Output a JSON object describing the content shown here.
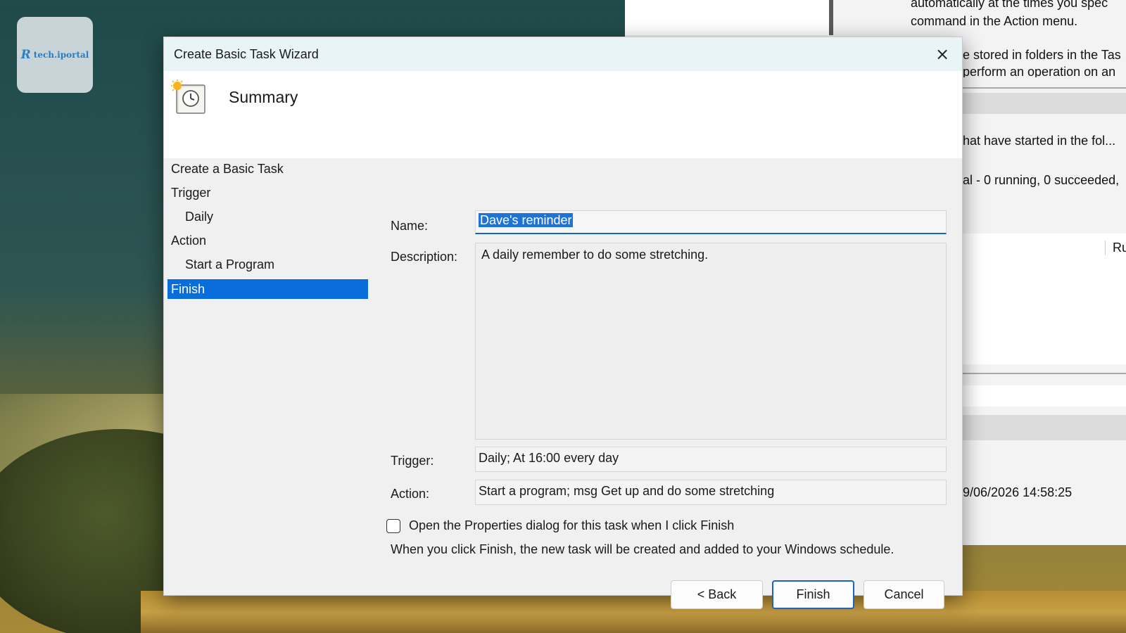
{
  "brand": {
    "mark": "R",
    "name": "tech.iportal",
    "color": "#2a7fc4"
  },
  "background_window": {
    "lines": [
      "automatically at the times you spec",
      "command in the Action menu.",
      "e stored in folders in the Tas",
      "perform an operation on an",
      "hat have started in the fol...",
      "al - 0 running, 0 succeeded,",
      "Run",
      "9/06/2026 14:58:25"
    ]
  },
  "dialog": {
    "title": "Create Basic Task Wizard",
    "close_icon": "×",
    "header_title": "Summary",
    "header_icon": "clock-task-icon",
    "steps": [
      {
        "label": "Create a Basic Task",
        "sub": false,
        "active": false
      },
      {
        "label": "Trigger",
        "sub": false,
        "active": false
      },
      {
        "label": "Daily",
        "sub": true,
        "active": false
      },
      {
        "label": "Action",
        "sub": false,
        "active": false
      },
      {
        "label": "Start a Program",
        "sub": true,
        "active": false
      },
      {
        "label": "Finish",
        "sub": false,
        "active": true
      }
    ],
    "name_label": "Name:",
    "name_value": "Dave's reminder",
    "description_label": "Description:",
    "description_value": "A daily remember to do some stretching.",
    "trigger_label": "Trigger:",
    "trigger_value": "Daily; At 16:00 every day",
    "action_label": "Action:",
    "action_value": "Start a program; msg Get up and do some stretching",
    "checkbox_label": "Open the Properties dialog for this task when I click Finish",
    "checkbox_checked": false,
    "info_text": "When you click Finish, the new task will be created and added to your Windows schedule.",
    "buttons": {
      "back": "< Back",
      "finish": "Finish",
      "cancel": "Cancel"
    },
    "accent_color": "#0a6ddc"
  }
}
